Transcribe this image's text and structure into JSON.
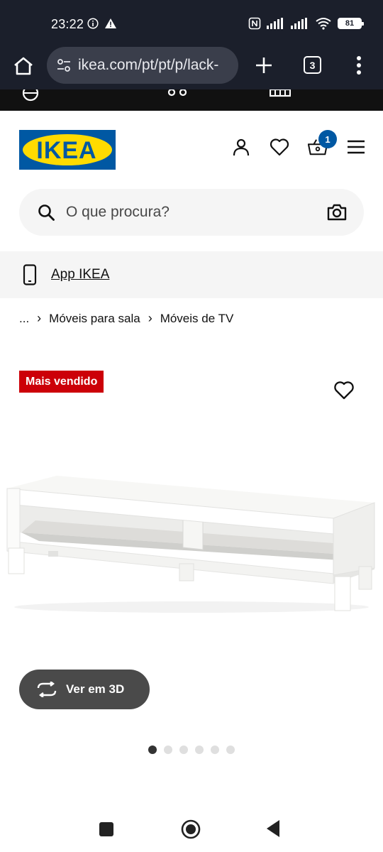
{
  "status_bar": {
    "time": "23:22",
    "battery": "81"
  },
  "browser": {
    "url": "ikea.com/pt/pt/p/lack-",
    "tab_count": "3"
  },
  "header": {
    "logo_text": "IKEA",
    "cart_count": "1"
  },
  "search": {
    "placeholder": "O que procura?"
  },
  "app_banner": {
    "label": "App IKEA"
  },
  "breadcrumb": {
    "ellipsis": "...",
    "items": [
      "Móveis para sala",
      "Móveis de TV"
    ]
  },
  "product": {
    "badge": "Mais vendido",
    "view_3d_label": "Ver em 3D",
    "carousel_total": 6,
    "carousel_active": 1
  },
  "colors": {
    "ikea_blue": "#0058a3",
    "ikea_yellow": "#ffdb00",
    "badge_red": "#cc0008",
    "browser_bg": "#1b1f2b"
  }
}
